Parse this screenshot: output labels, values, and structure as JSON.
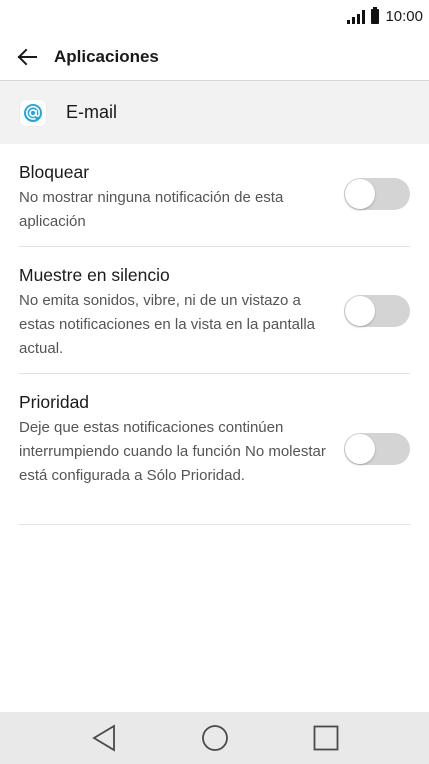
{
  "status_bar": {
    "time": "10:00",
    "icons": [
      "signal-icon",
      "battery-icon"
    ]
  },
  "app_bar": {
    "back_icon": "back-arrow-icon",
    "title": "Aplicaciones"
  },
  "app_header": {
    "icon": "email-at-icon",
    "icon_color": "#1ea7e1",
    "name": "E-mail"
  },
  "settings": [
    {
      "title": "Bloquear",
      "description": "No mostrar ninguna notificación de esta aplicación",
      "enabled": false
    },
    {
      "title": "Muestre en silencio",
      "description": "No emita sonidos, vibre, ni de un vistazo a estas notificaciones en la vista en la pantalla actual.",
      "enabled": false
    },
    {
      "title": "Prioridad",
      "description": "Deje que estas notificaciones continúen interrumpiendo cuando la función No molestar está configurada a Sólo Prioridad.",
      "enabled": false
    }
  ],
  "nav_bar": {
    "buttons": [
      "back-triangle-icon",
      "home-circle-icon",
      "recents-square-icon"
    ]
  },
  "colors": {
    "toggle_off_track": "#d4d4d4",
    "header_row_bg": "#f2f2f2",
    "nav_bar_bg": "#e9e9e9"
  }
}
